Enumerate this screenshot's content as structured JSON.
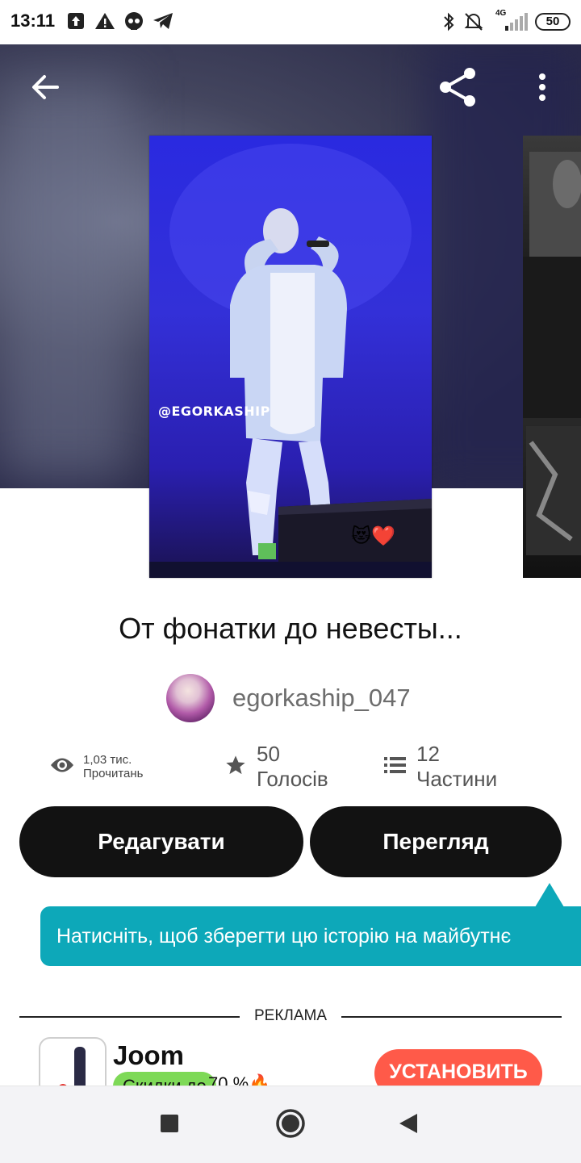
{
  "status_bar": {
    "time": "13:11",
    "network": "4G",
    "battery": "50",
    "left_icons": [
      "upload-icon",
      "warning-icon",
      "skull-icon",
      "telegram-icon"
    ],
    "right_icons": [
      "bluetooth-icon",
      "bell-off-icon",
      "signal-icon"
    ]
  },
  "header": {
    "back_icon": "back-arrow-icon",
    "share_icon": "share-icon",
    "menu_icon": "more-vertical-icon"
  },
  "cover": {
    "caption": "@EGORKASHIP",
    "emoji": "😻❤️"
  },
  "story": {
    "title": "От фонатки до невесты...",
    "author": "egorkaship_047"
  },
  "stats": {
    "reads": "1,03 тис. Прочитань",
    "votes": "50 Голосів",
    "parts": "12 Частини"
  },
  "actions": {
    "edit_label": "Редагувати",
    "preview_label": "Перегляд"
  },
  "tooltip": {
    "text": "Натисніть, щоб зберегти цю історію на майбутнє"
  },
  "ad": {
    "label": "РЕКЛАМА",
    "app_name": "Joom",
    "badge": "Скидки до",
    "extra": "70 %🔥",
    "install_label": "УСТАНОВИТЬ"
  },
  "colors": {
    "accent": "#0da8b9",
    "button": "#121212",
    "install": "#ff5a49",
    "badge": "#7ed957"
  },
  "nav": {
    "icons": [
      "recents-square-icon",
      "home-circle-icon",
      "back-triangle-icon"
    ]
  }
}
